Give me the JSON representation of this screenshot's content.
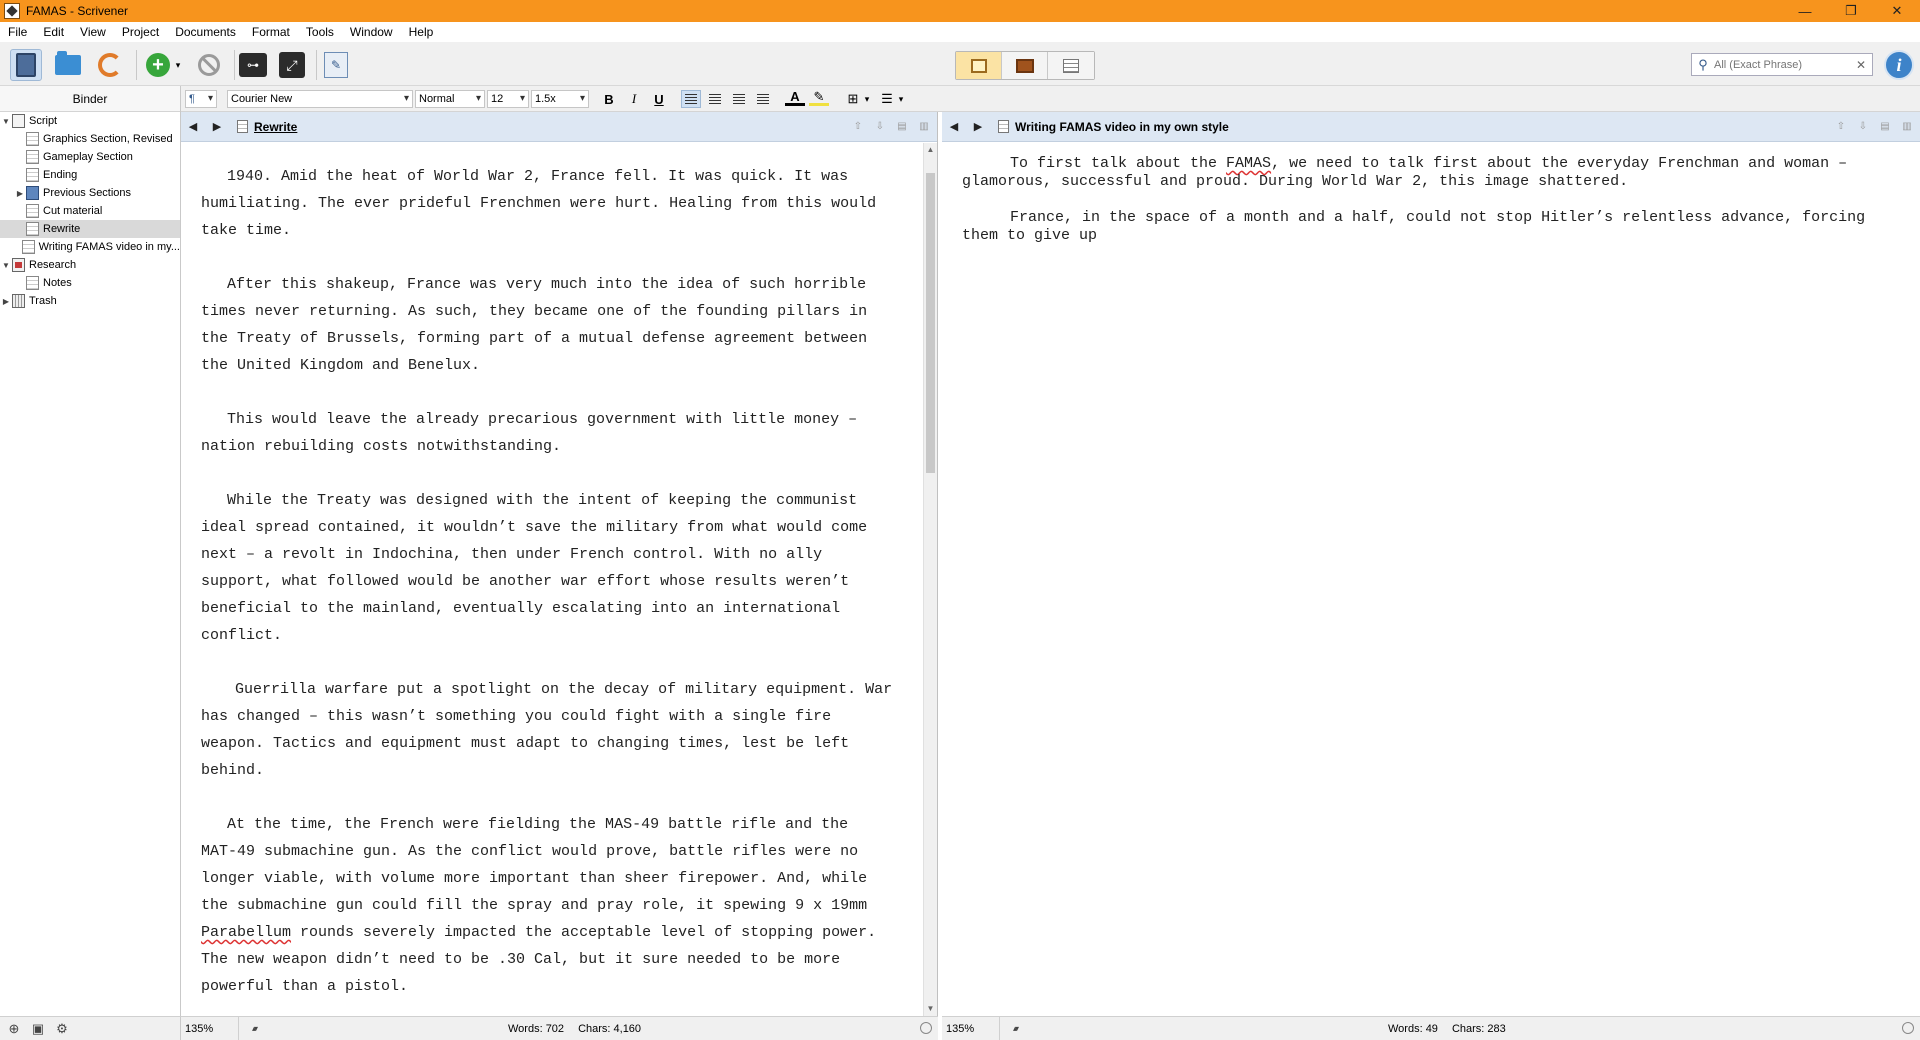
{
  "window": {
    "title": "FAMAS - Scrivener",
    "controls": {
      "minimize": "—",
      "restore": "❐",
      "close": "✕"
    }
  },
  "menu": [
    "File",
    "Edit",
    "View",
    "Project",
    "Documents",
    "Format",
    "Tools",
    "Window",
    "Help"
  ],
  "toolbar": {
    "search_placeholder": "All (Exact Phrase)",
    "info_label": "i",
    "key_label": "⊶",
    "inspect_label": "✎",
    "expand_label": "⤢"
  },
  "binder": {
    "header": "Binder",
    "items": [
      {
        "label": "Script",
        "icon": "folder-doc",
        "level": 0,
        "arrow": "▼"
      },
      {
        "label": "Graphics Section, Revised",
        "icon": "doc",
        "level": 1,
        "arrow": ""
      },
      {
        "label": "Gameplay Section",
        "icon": "doc",
        "level": 1,
        "arrow": ""
      },
      {
        "label": "Ending",
        "icon": "doc",
        "level": 1,
        "arrow": ""
      },
      {
        "label": "Previous Sections",
        "icon": "stack",
        "level": 1,
        "arrow": "▶"
      },
      {
        "label": "Cut material",
        "icon": "doc",
        "level": 1,
        "arrow": ""
      },
      {
        "label": "Rewrite",
        "icon": "doc",
        "level": 1,
        "arrow": "",
        "selected": true
      },
      {
        "label": "Writing FAMAS video in my...",
        "icon": "doc",
        "level": 1,
        "arrow": ""
      },
      {
        "label": "Research",
        "icon": "research",
        "level": 0,
        "arrow": "▼"
      },
      {
        "label": "Notes",
        "icon": "doc",
        "level": 1,
        "arrow": ""
      },
      {
        "label": "Trash",
        "icon": "trash",
        "level": 0,
        "arrow": "▶"
      }
    ]
  },
  "format": {
    "style": "¶",
    "font": "Courier New",
    "typeface": "Normal",
    "size": "12",
    "spacing": "1.5x",
    "bold": "B",
    "italic": "I",
    "underline": "U",
    "text_color": "A"
  },
  "left_editor": {
    "title": "Rewrite",
    "paragraphs": [
      "1940. Amid the heat of World War 2, France fell. It was quick. It was humiliating. The ever prideful Frenchmen were hurt. Healing from this would take time.",
      "After this shakeup, France was very much into the idea of such horrible times never returning. As such, they became one of the founding pillars in the Treaty of Brussels, forming part of a mutual defense agreement between the United Kingdom and Benelux.",
      "This would leave the already precarious government with little money – nation rebuilding costs notwithstanding.",
      "While the Treaty was designed with the intent of keeping the communist ideal spread contained, it wouldn’t save the military from what would come next – a revolt in Indochina, then under French control. With no ally support, what followed would be another war effort whose results weren’t beneficial to the mainland, eventually escalating into an international conflict.",
      "Guerrilla warfare put a spotlight on the decay of military equipment. War has changed – this wasn’t something you could fight with a single fire weapon. Tactics and equipment must adapt to changing times, lest be left behind."
    ],
    "last_paragraph_before": "At the time, the French were fielding the MAS-49 battle rifle and the MAT-49 submachine gun. As the conflict would prove, battle rifles were no longer viable, with volume more important than sheer firepower. And, while the submachine gun could fill the spray and pray role, it spewing 9 x 19mm ",
    "last_paragraph_misspelled": "Parabellum",
    "last_paragraph_after": " rounds severely impacted the acceptable level of stopping power. The new weapon didn’t need to be .30 Cal, but it sure needed to be more powerful than a pistol.",
    "zoom": "135%",
    "words": "Words: 702",
    "chars": "Chars: 4,160"
  },
  "right_editor": {
    "title": "Writing FAMAS video in my own style",
    "p1_before": "To first talk about the ",
    "p1_misspelled": "FAMAS",
    "p1_after": ", we need to talk first about the everyday Frenchman and woman – glamorous, successful and proud. During World War 2, this image shattered.",
    "p2": "France, in the space of a month and a half, could not stop Hitler’s relentless advance, forcing them to give up",
    "zoom": "135%",
    "words": "Words: 49",
    "chars": "Chars: 283"
  }
}
